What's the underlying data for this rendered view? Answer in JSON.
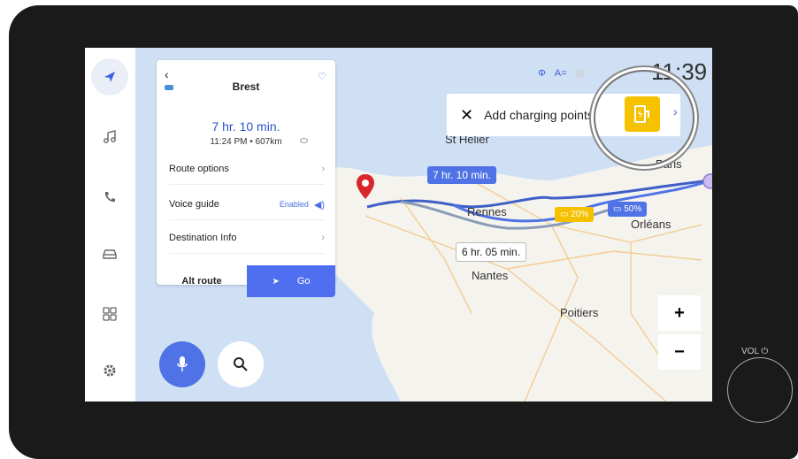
{
  "colors": {
    "accent": "#4f73e6",
    "ev_yellow": "#f6c200",
    "bezel": "#1a1a1a",
    "map_bg": "#cfe0f4"
  },
  "rail": {
    "items": [
      {
        "icon": "navigation-icon"
      },
      {
        "icon": "music-icon"
      },
      {
        "icon": "phone-icon"
      },
      {
        "icon": "car-icon"
      },
      {
        "icon": "apps-grid-icon"
      },
      {
        "icon": "settings-gear-icon"
      }
    ]
  },
  "panel": {
    "back": "‹",
    "destination": "Brest",
    "duration": "7 hr. 10 min.",
    "eta": "11:24 PM • 607km",
    "route_options": "Route options",
    "voice_guide": "Voice guide",
    "voice_status": "Enabled",
    "destination_info": "Destination Info",
    "alt_route": "Alt route",
    "go": "Go"
  },
  "status": {
    "time": "11:39",
    "lang": "A="
  },
  "banner": {
    "close": "✕",
    "text": "Add charging points",
    "chevron": "›"
  },
  "map": {
    "route_time_main": "7 hr. 10 min.",
    "route_time_alt": "6 hr. 05 min.",
    "battery_low": "20%",
    "battery_high": "50%",
    "cities": [
      "St Helier",
      "Paris",
      "Rennes",
      "Orléans",
      "Nantes",
      "Poitiers"
    ]
  },
  "zoom": {
    "in": "+",
    "out": "−"
  },
  "hardware": {
    "vol_label": "VOL"
  }
}
